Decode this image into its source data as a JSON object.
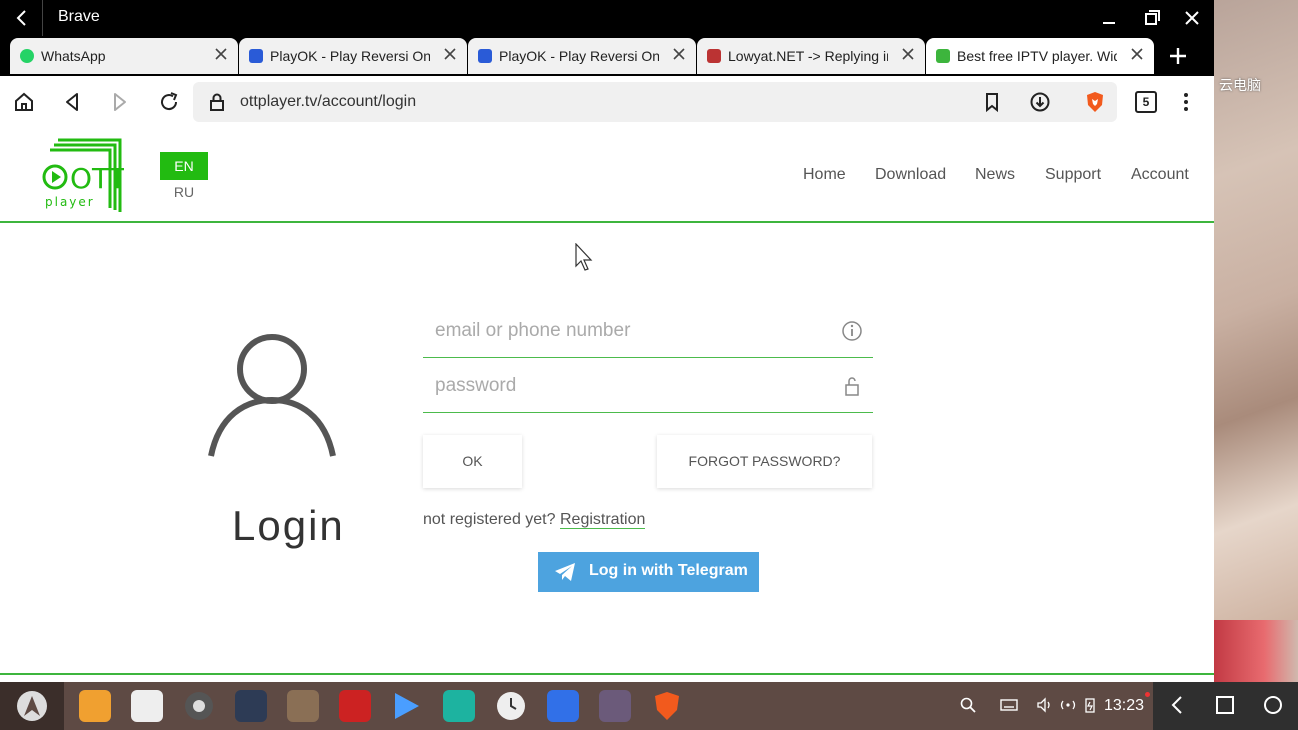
{
  "window": {
    "title": "Brave"
  },
  "tabs": [
    {
      "title": "WhatsApp",
      "icon": "whatsapp-icon",
      "color": "#25d366"
    },
    {
      "title": "PlayOK - Play Reversi Online",
      "icon": "playok-icon",
      "color": "#2a5bd7"
    },
    {
      "title": "PlayOK - Play Reversi Online",
      "icon": "playok-icon",
      "color": "#2a5bd7"
    },
    {
      "title": "Lowyat.NET -> Replying in",
      "icon": "lowyat-icon",
      "color": "#b33"
    },
    {
      "title": "Best free IPTV player. Widg",
      "icon": "ottplayer-icon",
      "color": "#3db53d"
    }
  ],
  "toolbar": {
    "url": "ottplayer.tv/account/login",
    "tab_count": "5"
  },
  "site": {
    "logo_text": "OTT",
    "logo_sub": "player",
    "lang_en": "EN",
    "lang_ru": "RU",
    "nav": [
      "Home",
      "Download",
      "News",
      "Support",
      "Account"
    ],
    "accent": "#3db53d"
  },
  "login": {
    "title": "Login",
    "email_placeholder": "email or phone number",
    "password_placeholder": "password",
    "ok_label": "OK",
    "forgot_label": "FORGOT PASSWORD?",
    "not_registered": "not registered yet?",
    "registration_link": "Registration",
    "telegram_label": "Log in with Telegram"
  },
  "desktop": {
    "wallpaper_label": "云电脑"
  },
  "taskbar": {
    "time": "13:23"
  }
}
